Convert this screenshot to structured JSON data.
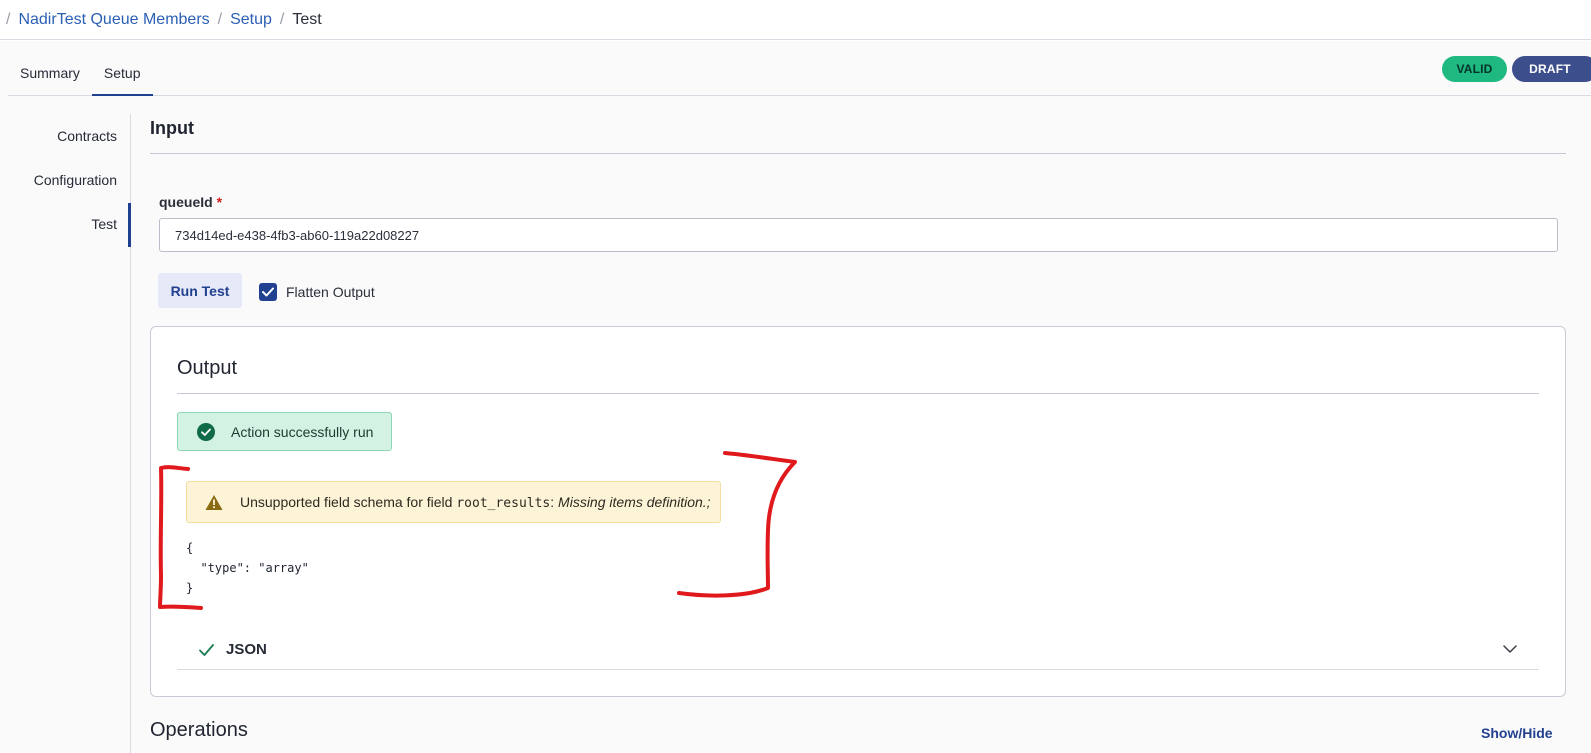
{
  "breadcrumb": {
    "separator": "/",
    "items": [
      {
        "label": "NadirTest Queue Members"
      },
      {
        "label": "Setup"
      },
      {
        "label": "Test"
      }
    ]
  },
  "tabs": [
    {
      "label": "Summary",
      "active": false
    },
    {
      "label": "Setup",
      "active": true
    }
  ],
  "badges": {
    "valid": "VALID",
    "draft": "DRAFT"
  },
  "sidebar": {
    "items": [
      {
        "label": "Contracts"
      },
      {
        "label": "Configuration"
      },
      {
        "label": "Test"
      }
    ],
    "active_index": 2
  },
  "input": {
    "title": "Input",
    "field_label": "queueId",
    "required_marker": "*",
    "field_value": "734d14ed-e438-4fb3-ab60-119a22d08227",
    "run_button": "Run Test",
    "flatten_label": "Flatten Output",
    "flatten_checked": true
  },
  "output": {
    "title": "Output",
    "success_message": "Action successfully run",
    "warning": {
      "prefix": "Unsupported field schema for field ",
      "field": "root_results",
      "colon": ": ",
      "detail": "Missing items definition.;"
    },
    "json_code": "{\n  \"type\": \"array\"\n}",
    "json_section_label": "JSON"
  },
  "operations": {
    "title": "Operations",
    "toggle": "Show/Hide"
  },
  "colors": {
    "accent": "#21408f",
    "link": "#2b5fb4",
    "success_bg": "#d4f2e4",
    "warning_bg": "#fdf4d8",
    "valid_badge": "#1eb980",
    "draft_badge": "#3d4e8c",
    "annotation": "#e0191c"
  },
  "icons": {
    "success": "check-circle-icon",
    "warning": "warning-triangle-icon",
    "json_status": "check-icon",
    "expand": "chevron-down-icon",
    "checkbox": "checkmark-icon"
  }
}
